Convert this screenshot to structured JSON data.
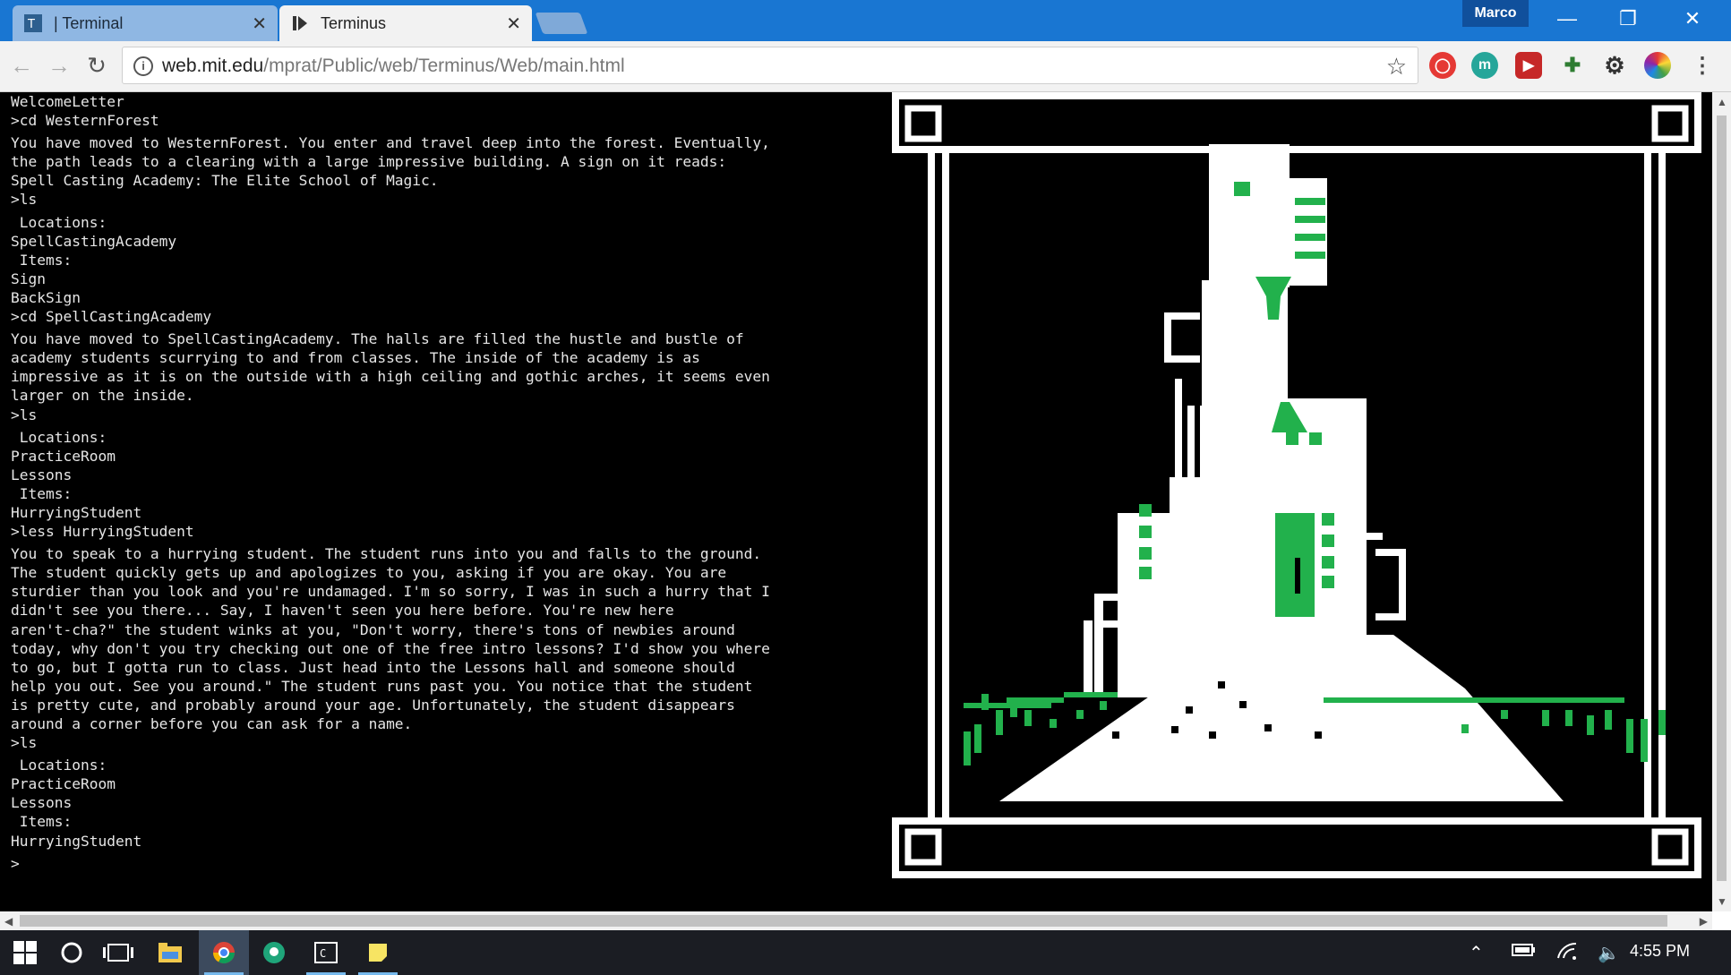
{
  "browser": {
    "tabs": [
      {
        "title": "| Terminal",
        "active": false
      },
      {
        "title": "Terminus",
        "active": true
      }
    ],
    "profile_name": "Marco",
    "url_host": "web.mit.edu",
    "url_path": "/mprat/Public/web/Terminus/Web/main.html"
  },
  "terminal": {
    "lines": [
      "WelcomeLetter",
      ">cd WesternForest",
      "",
      "You have moved to WesternForest. You enter and travel deep into the forest. Eventually,",
      "the path leads to a clearing with a large impressive building. A sign on it reads:",
      "Spell Casting Academy: The Elite School of Magic.",
      ">ls",
      "",
      " Locations:",
      "SpellCastingAcademy",
      " Items:",
      "Sign",
      "BackSign",
      ">cd SpellCastingAcademy",
      "",
      "You have moved to SpellCastingAcademy. The halls are filled the hustle and bustle of",
      "academy students scurrying to and from classes. The inside of the academy is as",
      "impressive as it is on the outside with a high ceiling and gothic arches, it seems even",
      "larger on the inside.",
      ">ls",
      "",
      " Locations:",
      "PracticeRoom",
      "Lessons",
      " Items:",
      "HurryingStudent",
      ">less HurryingStudent",
      "",
      "You to speak to a hurrying student. The student runs into you and falls to the ground.",
      "The student quickly gets up and apologizes to you, asking if you are okay. You are",
      "sturdier than you look and you're undamaged. I'm so sorry, I was in such a hurry that I",
      "didn't see you there... Say, I haven't seen you here before. You're new here",
      "aren't-cha?\" the student winks at you, \"Don't worry, there's tons of newbies around",
      "today, why don't you try checking out one of the free intro lessons? I'd show you where",
      "to go, but I gotta run to class. Just head into the Lessons hall and someone should",
      "help you out. See you around.\" The student runs past you. You notice that the student",
      "is pretty cute, and probably around your age. Unfortunately, the student disappears",
      "around a corner before you can ask for a name.",
      ">ls",
      "",
      " Locations:",
      "PracticeRoom",
      "Lessons",
      " Items:",
      "HurryingStudent",
      "",
      ">"
    ]
  },
  "art": {
    "accent_color": "#22b14c",
    "frame_color": "#ffffff",
    "background_color": "#000000",
    "subject": "castle-tower-pixel-art"
  },
  "taskbar": {
    "clock": "4:55 PM",
    "apps": [
      "windows-start",
      "cortana",
      "task-view",
      "file-explorer",
      "chrome",
      "gitkraken",
      "terminal-app",
      "sticky-notes"
    ]
  },
  "colors": {
    "titlebar": "#1976d2",
    "taskbar": "#1b1d23"
  }
}
